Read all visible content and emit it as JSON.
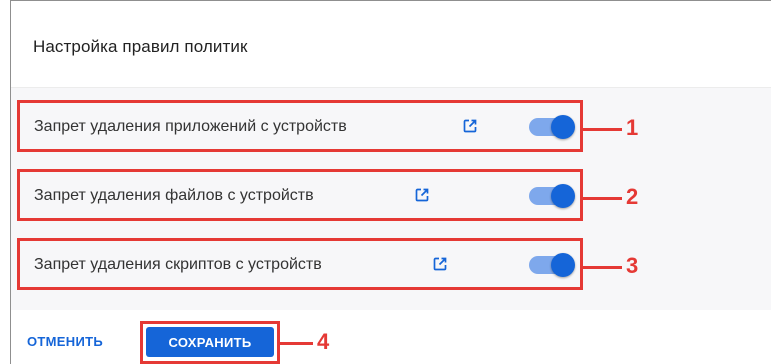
{
  "dialog": {
    "title": "Настройка правил политик"
  },
  "rules": [
    {
      "label": "Запрет удаления приложений с устройств",
      "enabled": true,
      "callout": "1"
    },
    {
      "label": "Запрет удаления файлов с устройств",
      "enabled": true,
      "callout": "2"
    },
    {
      "label": "Запрет удаления скриптов с устройств",
      "enabled": true,
      "callout": "3"
    }
  ],
  "footer": {
    "cancel_label": "ОТМЕНИТЬ",
    "save_label": "СОХРАНИТЬ",
    "save_callout": "4"
  },
  "colors": {
    "accent": "#1565d8",
    "toggle_track": "#7ea8ec",
    "highlight": "#e53935"
  },
  "icons": {
    "external_link": "external-link-icon"
  }
}
